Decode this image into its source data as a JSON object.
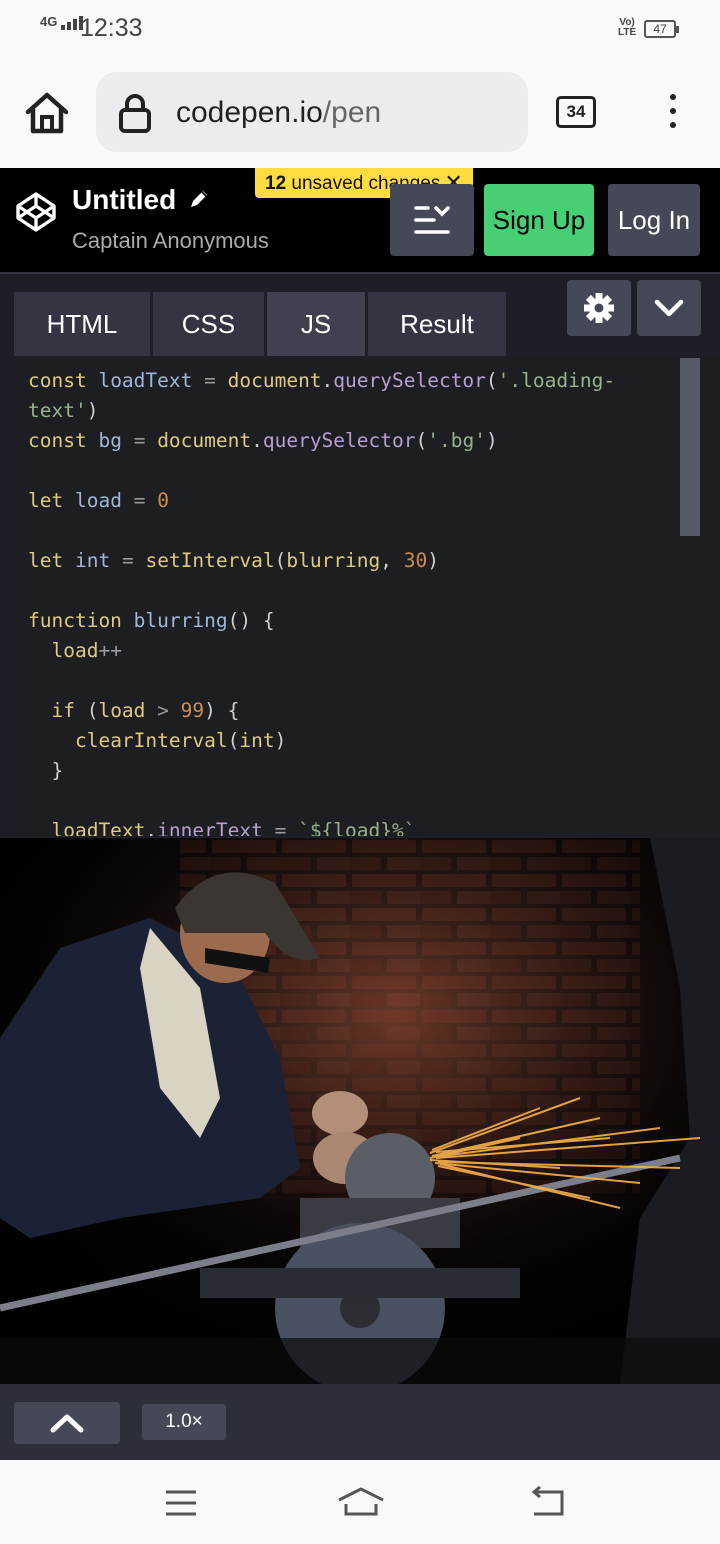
{
  "status_bar": {
    "network": "4G",
    "time": "12:33",
    "volte": "VoLTE",
    "battery": "47"
  },
  "browser": {
    "url_host": "codepen.io",
    "url_path": "/pen",
    "tab_count": "34"
  },
  "pen": {
    "title": "Untitled",
    "author": "Captain Anonymous",
    "unsaved_count": "12",
    "unsaved_text": "unsaved changes",
    "signup_label": "Sign Up",
    "login_label": "Log In"
  },
  "editor_tabs": [
    "HTML",
    "CSS",
    "JS",
    "Result"
  ],
  "active_tab": "JS",
  "code_lines": [
    "const loadText = document.querySelector('.loading-",
    "text')",
    "const bg = document.querySelector('.bg')",
    "",
    "let load = 0",
    "",
    "let int = setInterval(blurring, 30)",
    "",
    "function blurring() {",
    "  load++",
    "",
    "  if (load > 99) {",
    "    clearInterval(int)",
    "  }",
    "",
    "  loadText.innerText = `${load}%`"
  ],
  "footer": {
    "zoom": "1.0×"
  },
  "icons": {
    "home": "home-icon",
    "lock": "lock-icon",
    "menu": "more-vert-icon",
    "logo": "codepen-logo-icon",
    "pencil": "pencil-icon",
    "close": "close-icon",
    "layout": "layout-icon",
    "settings": "gear-icon",
    "collapse": "chevron-down-icon",
    "expand": "chevron-up-icon"
  },
  "colors": {
    "signup": "#47cf73",
    "unsaved": "#ffdd40",
    "header": "#000000",
    "editor": "#1d1e22"
  }
}
